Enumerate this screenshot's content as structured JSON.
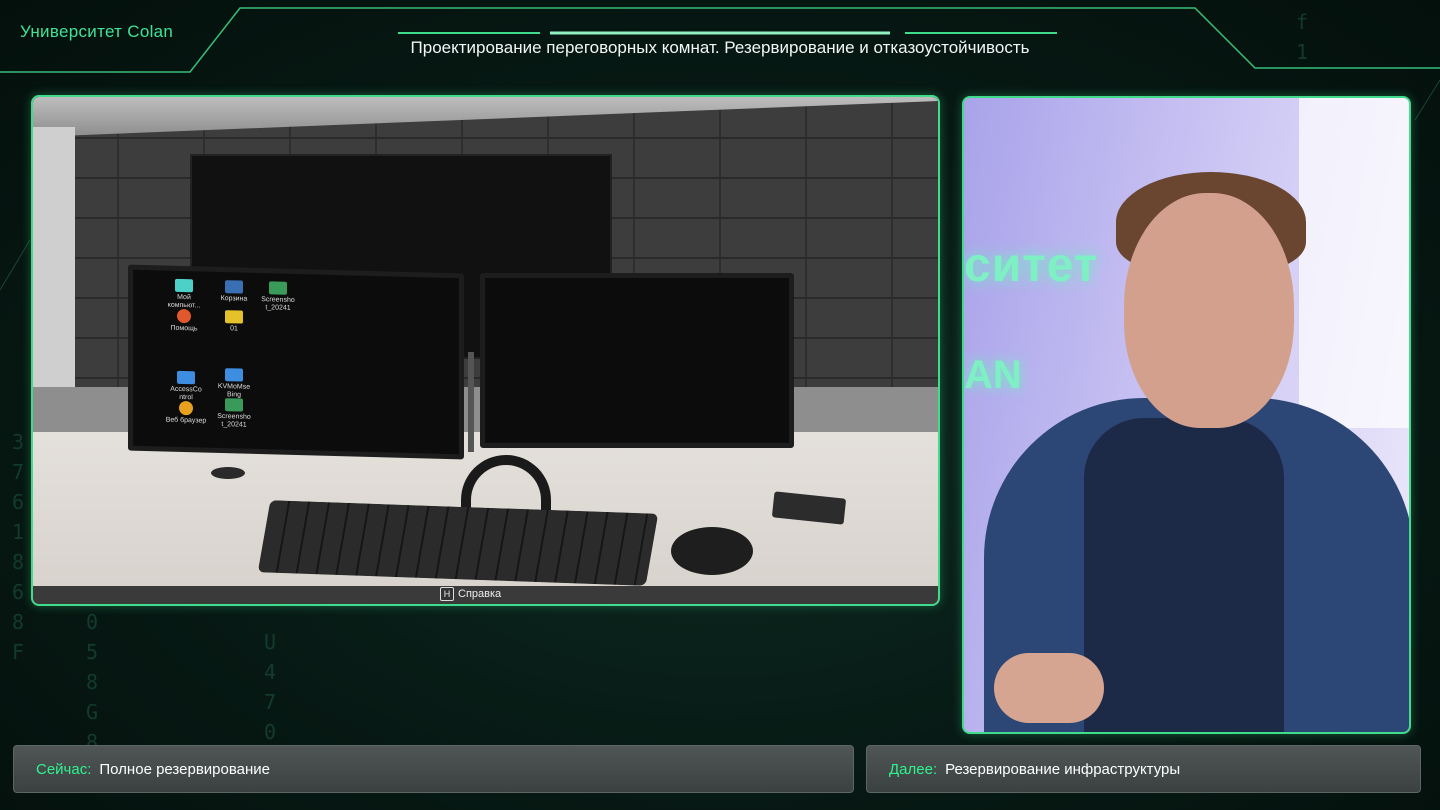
{
  "header": {
    "brand": "Университет Colan",
    "title": "Проектирование переговорных комнат. Резервирование и отказоустойчивость"
  },
  "scene": {
    "desktop_icons": [
      {
        "label": "Мой компьют...",
        "color": "#4dd0c8"
      },
      {
        "label": "Корзина",
        "color": "#3b6fb3"
      },
      {
        "label": "Screensho t_20241",
        "color": "#3a9a5a"
      },
      {
        "label": "Помощь",
        "color": "#e0582b"
      },
      {
        "label": "01",
        "color": "#e6c22a"
      },
      {
        "label": "AccessCo ntrol",
        "color": "#3d8de0"
      },
      {
        "label": "KVMoMse Bing",
        "color": "#3d8de0"
      },
      {
        "label": "Веб браузер",
        "color": "#e8a020"
      },
      {
        "label": "Screensho t_20241",
        "color": "#3a9a5a"
      }
    ],
    "hint_key": "H",
    "hint_label": "Справка"
  },
  "presenter": {
    "neon_line1": "ситет",
    "neon_line2": "AN"
  },
  "footer": {
    "now_label": "Сейчас:",
    "now_value": "Полное резервирование",
    "next_label": "Далее:",
    "next_value": "Резервирование инфраструктуры"
  },
  "colors": {
    "accent": "#3fdc8c",
    "label_green": "#2ff28e",
    "background": "#071914"
  }
}
